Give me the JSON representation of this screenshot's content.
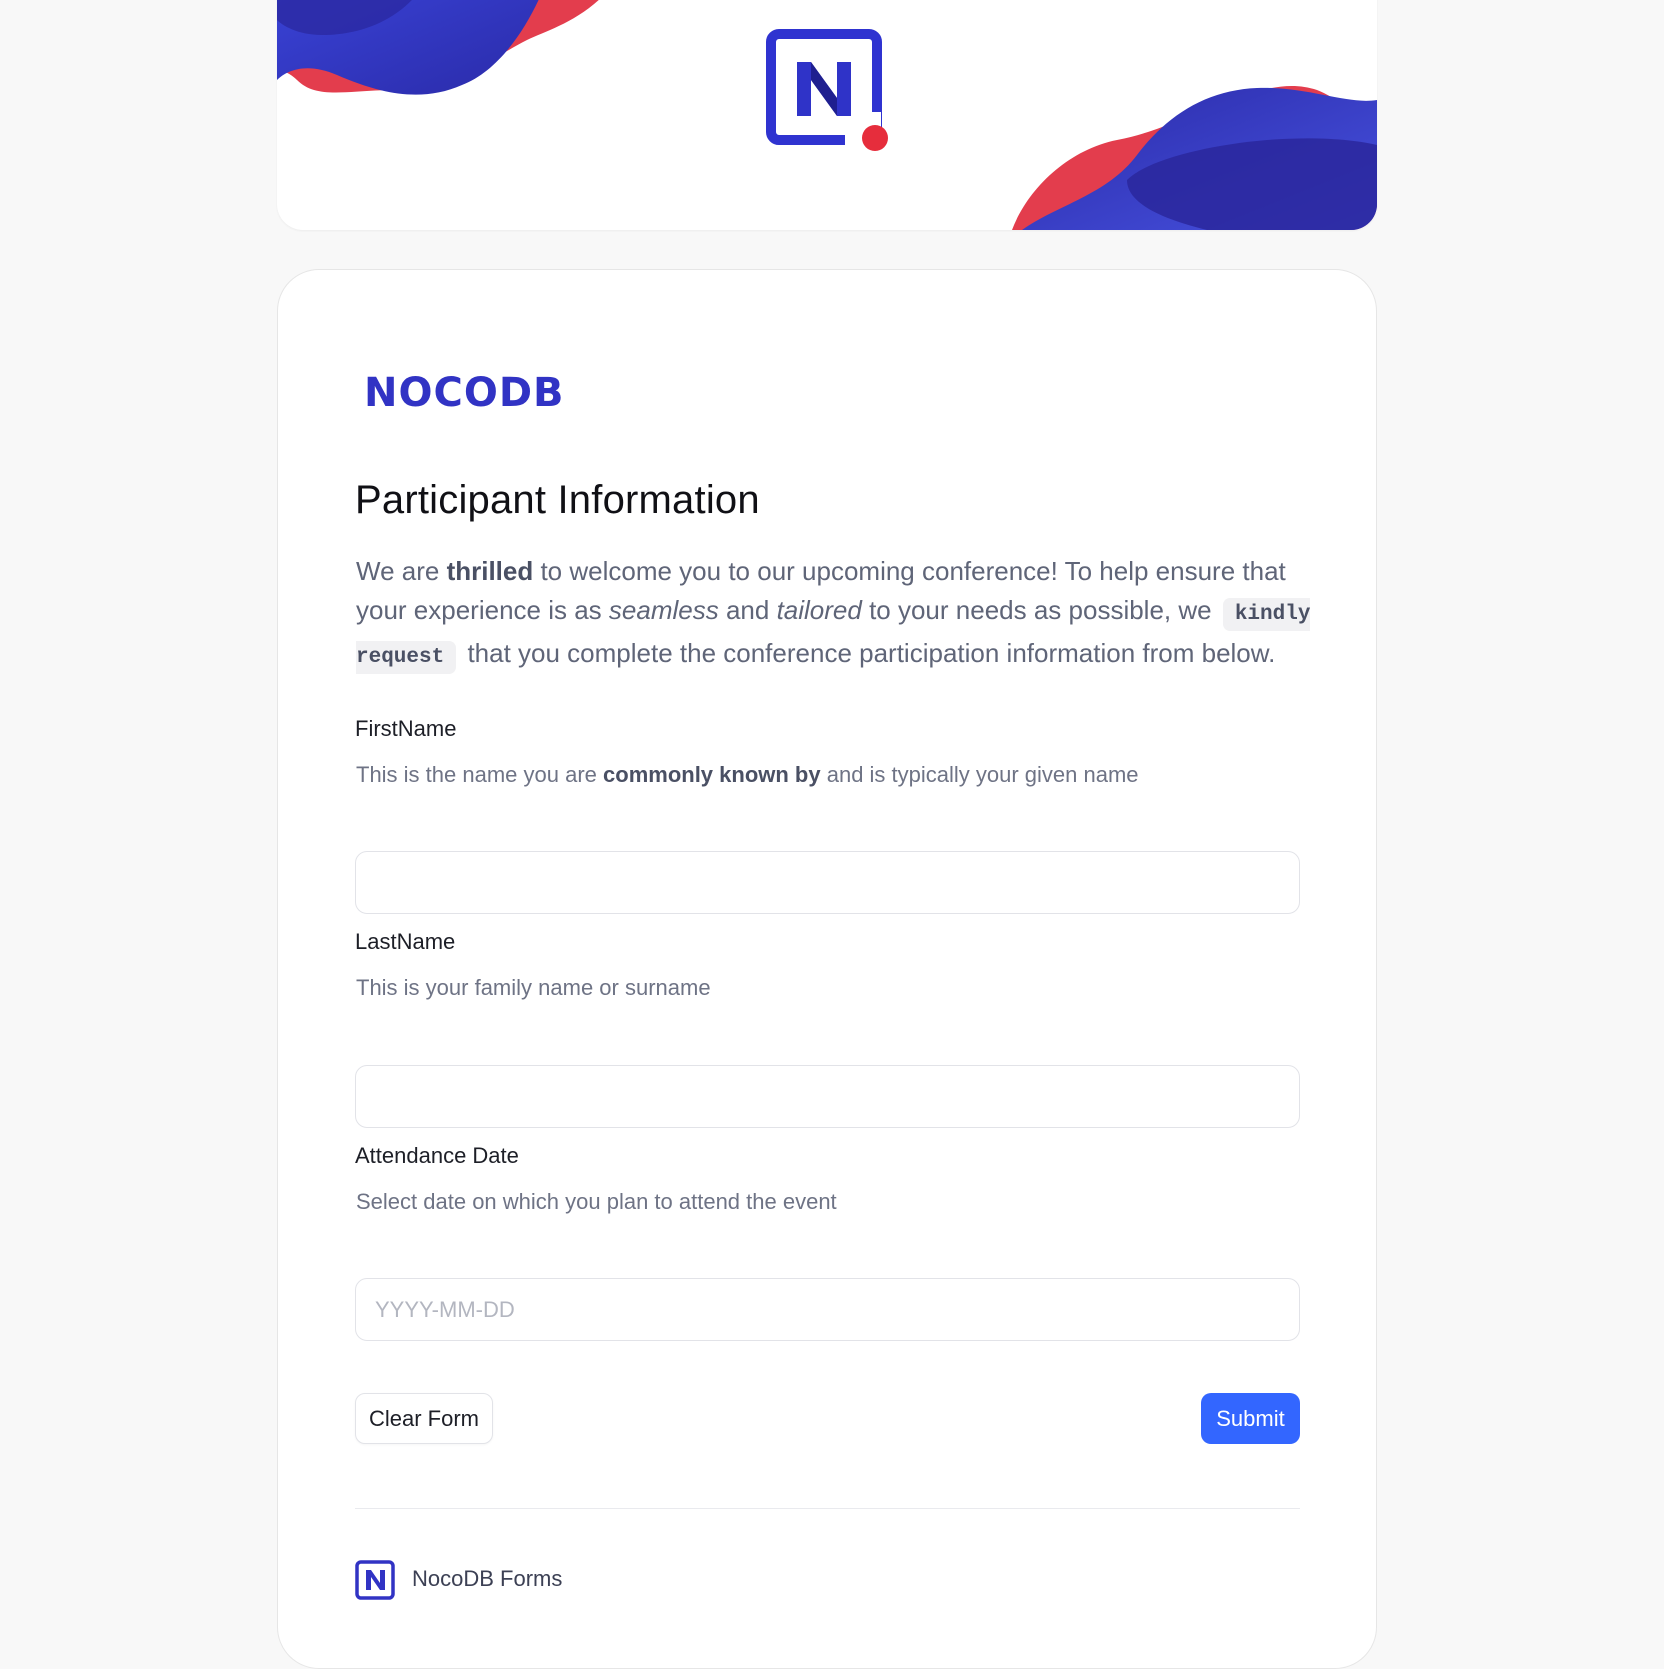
{
  "colors": {
    "brand_blue": "#3133c4",
    "accent_red": "#e63946",
    "submit_blue": "#3366ff"
  },
  "header": {
    "logo_icon": "nocodb-logo-icon",
    "wordmark": "NOCODB"
  },
  "form": {
    "title": "Participant Information",
    "description": {
      "part1": "We are ",
      "bold1": "thrilled",
      "part2": " to welcome you to our upcoming conference! To help ensure that your experience is as ",
      "italic1": "seamless",
      "part3": " and ",
      "italic2": "tailored",
      "part4": " to your needs as possible, we ",
      "code1": "kindly request",
      "part5": " that you complete the conference participation information from below."
    },
    "fields": [
      {
        "label": "FirstName",
        "help_pre": "This is the name you are ",
        "help_bold": "commonly known by",
        "help_post": " and is typically your given name",
        "value": "",
        "placeholder": ""
      },
      {
        "label": "LastName",
        "help": "This is your family name or surname",
        "value": "",
        "placeholder": ""
      },
      {
        "label": "Attendance Date",
        "help": "Select date on which you plan to attend the event",
        "value": "",
        "placeholder": "YYYY-MM-DD"
      }
    ],
    "clear_label": "Clear Form",
    "submit_label": "Submit"
  },
  "footer": {
    "brand_icon": "nocodb-small-logo-icon",
    "text": "NocoDB Forms"
  }
}
